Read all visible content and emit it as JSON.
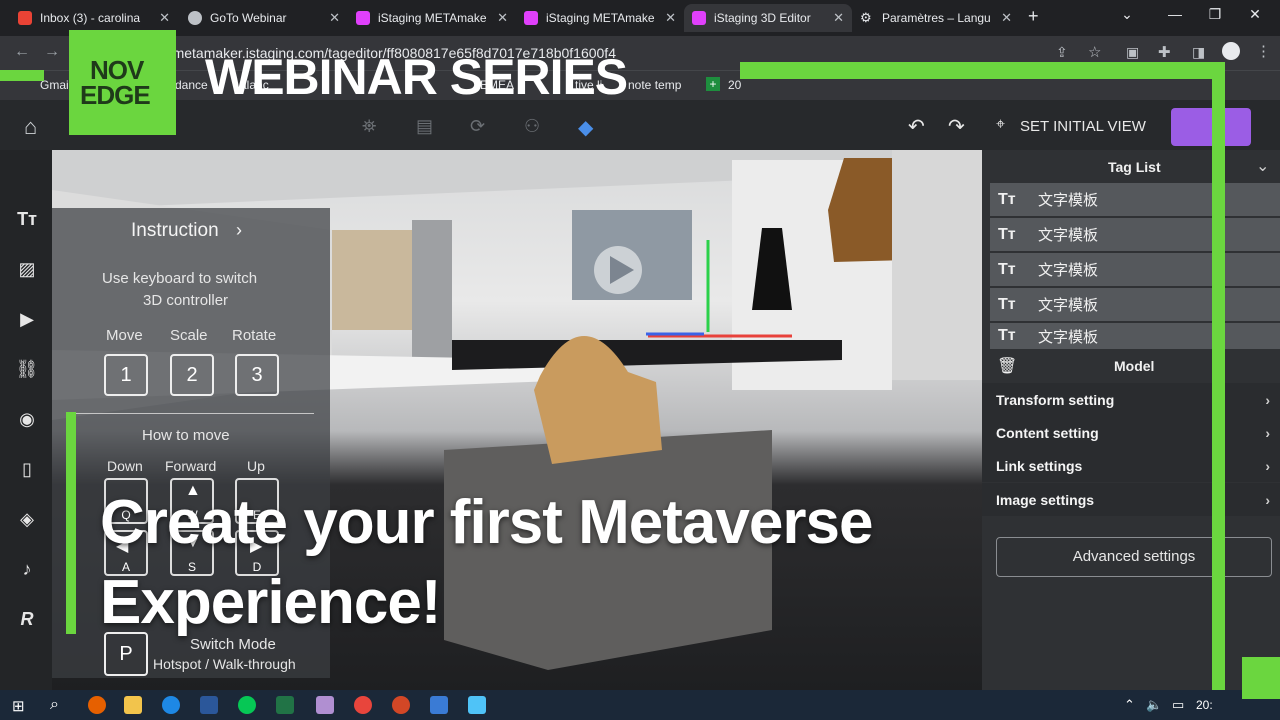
{
  "browser": {
    "tabs": [
      {
        "label": "Inbox (3) - carolina",
        "color": "#ea4335"
      },
      {
        "label": "GoTo Webinar",
        "color": "#bdc1c6"
      },
      {
        "label": "iStaging METAmake",
        "color": "#e040fb"
      },
      {
        "label": "iStaging METAmake",
        "color": "#e040fb"
      },
      {
        "label": "iStaging 3D Editor",
        "color": "#e040fb"
      },
      {
        "label": "Paramètres – Langu",
        "color": "#bdc1c6"
      }
    ],
    "url": "itor.metamaker.istaging.com/tageditor/ff8080817e65f8d7017e718b0f1600f4",
    "bookmarks": [
      "Gmai",
      "dance",
      "alanc",
      "EMEA",
      "tive li",
      "note temp",
      "20"
    ]
  },
  "overlay": {
    "brand_top": "NOV",
    "brand_bottom": "EDGE",
    "series_title": "WEBINAR SERIES",
    "headline_line1": "Create your first Metaverse",
    "headline_line2": "Experience!"
  },
  "editor": {
    "set_initial_view": "SET INITIAL VIEW",
    "instruction": {
      "title": "Instruction",
      "subtitle_line1": "Use keyboard to switch",
      "subtitle_line2": "3D controller",
      "modes": [
        {
          "label": "Move",
          "key": "1"
        },
        {
          "label": "Scale",
          "key": "2"
        },
        {
          "label": "Rotate",
          "key": "3"
        }
      ],
      "how_to_move": "How to move",
      "dirs": [
        "Down",
        "Forward",
        "Up"
      ],
      "keys": [
        "Q",
        "W",
        "E",
        "A",
        "S",
        "D"
      ],
      "switch_key": "P",
      "switch_title": "Switch Mode",
      "switch_sub": "Hotspot / Walk-through"
    },
    "tag_list": {
      "title": "Tag List",
      "items": [
        "文字模板",
        "文字模板",
        "文字模板",
        "文字模板",
        "文字模板"
      ]
    },
    "model": {
      "title": "Model",
      "settings": [
        "Transform setting",
        "Content setting",
        "Link settings",
        "Image settings"
      ],
      "advanced": "Advanced settings"
    }
  },
  "taskbar": {
    "time": "20:"
  }
}
